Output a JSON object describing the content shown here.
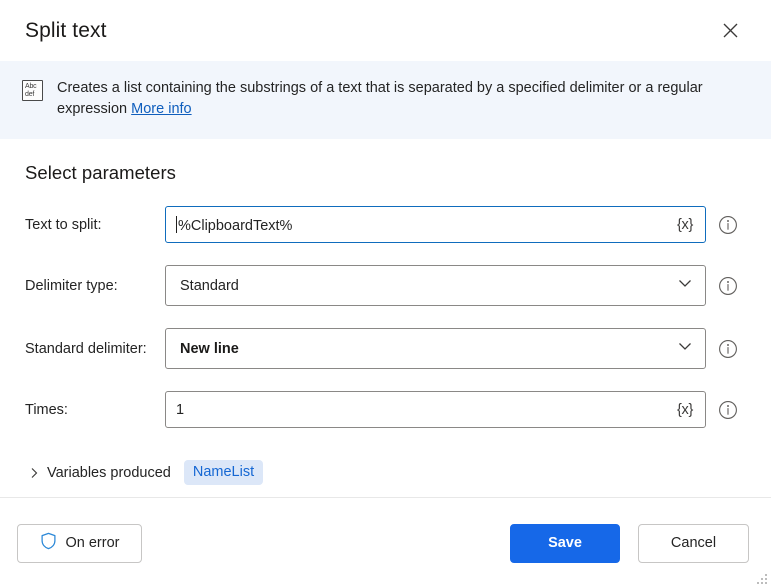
{
  "window": {
    "title": "Split text",
    "close_label": "×"
  },
  "banner": {
    "icon": "abc-def-text-icon",
    "icon_line1": "Abc",
    "icon_line2": "def",
    "text": "Creates a list containing the substrings of a text that is separated by a specified delimiter or a regular expression",
    "link_label": "More info"
  },
  "main": {
    "section_title": "Select parameters",
    "fields": [
      {
        "label": "Text to split:",
        "type": "textbox",
        "value": "%ClipboardText%",
        "var_button": "{x}",
        "focused": true,
        "info": "info-icon"
      },
      {
        "label": "Delimiter type:",
        "type": "dropdown",
        "value": "Standard",
        "info": "info-icon"
      },
      {
        "label": "Standard delimiter:",
        "type": "dropdown",
        "value": "New line",
        "info": "info-icon"
      },
      {
        "label": "Times:",
        "type": "textbox",
        "value": "1",
        "var_button": "{x}",
        "focused": false,
        "info": "info-icon"
      }
    ],
    "variables_produced": {
      "label": "Variables produced",
      "expanded": false,
      "badges": [
        "NameList"
      ]
    }
  },
  "footer": {
    "on_error_label": "On error",
    "save_label": "Save",
    "cancel_label": "Cancel"
  },
  "colors": {
    "accent": "#1668e8",
    "link": "#0f5ebd",
    "banner_bg": "#f2f6fc",
    "badge_bg": "#dce7f8",
    "badge_text": "#1567d3",
    "focus_border": "#0f6cbd",
    "shield_icon": "#2b88d8"
  }
}
